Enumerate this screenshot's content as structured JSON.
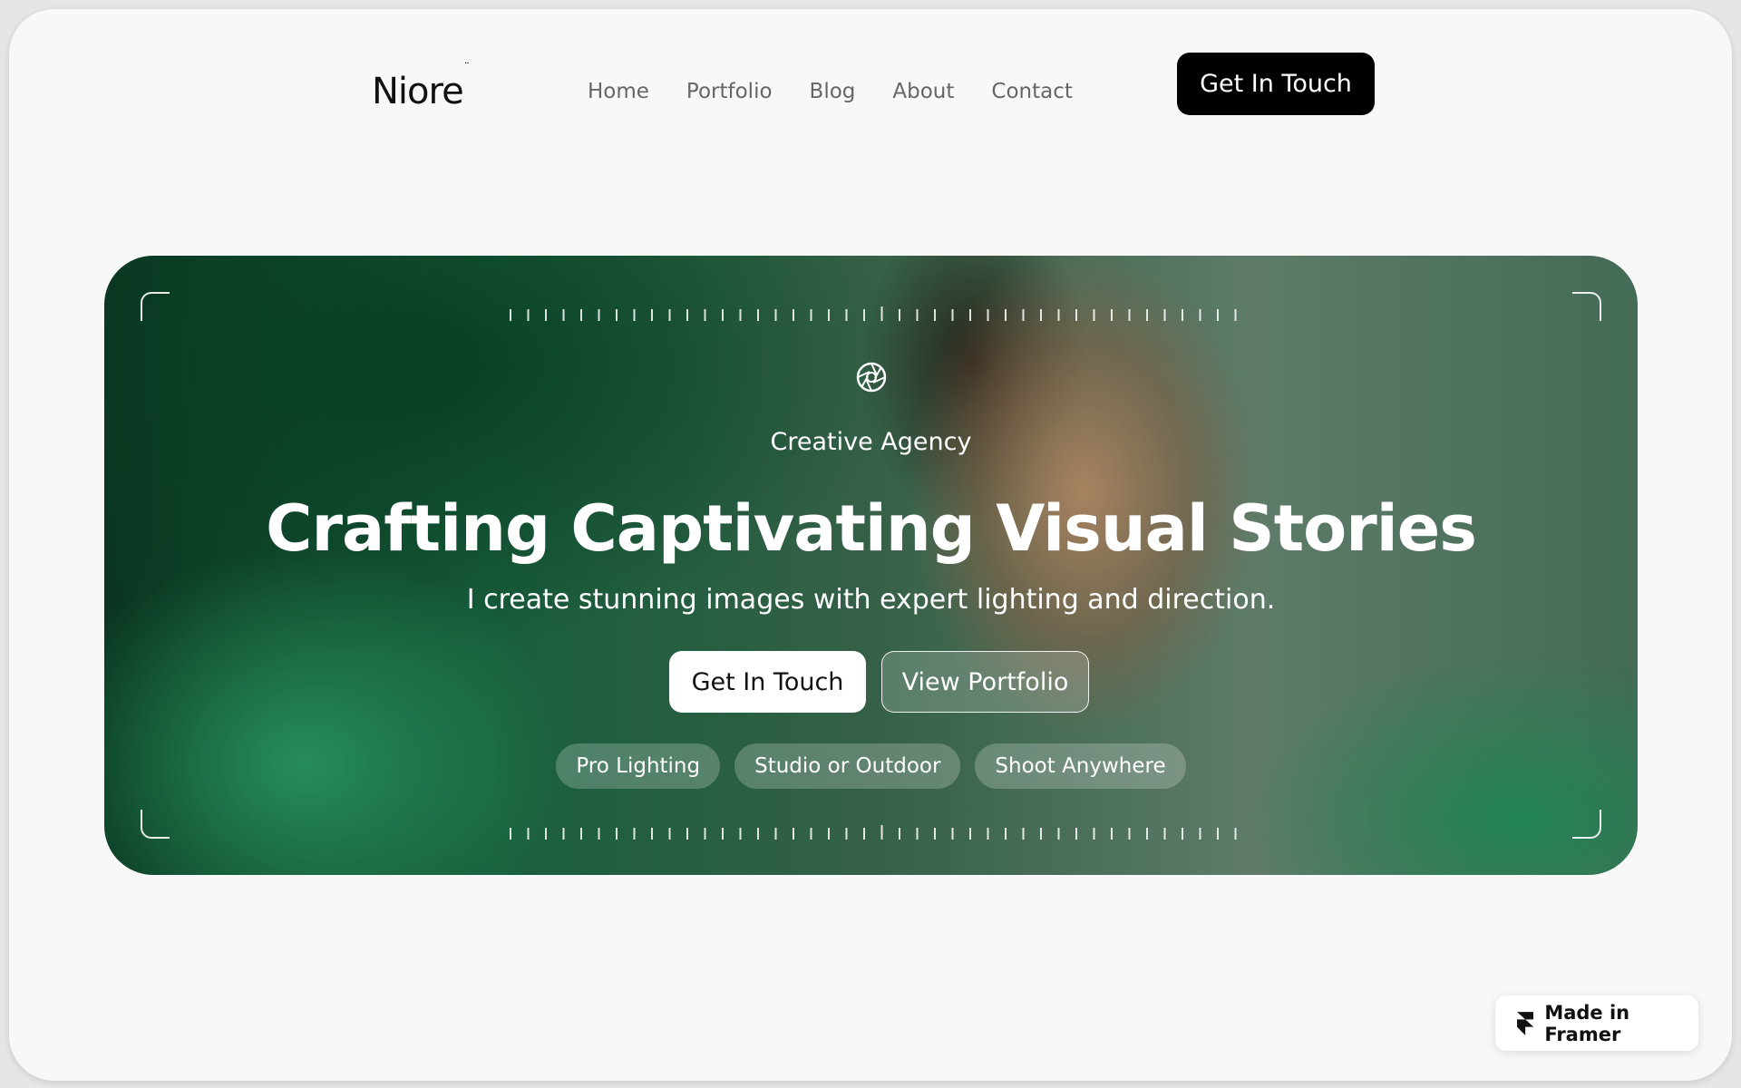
{
  "brand": {
    "name": "Niore",
    "mark": "¨"
  },
  "nav": {
    "items": [
      {
        "label": "Home"
      },
      {
        "label": "Portfolio"
      },
      {
        "label": "Blog"
      },
      {
        "label": "About"
      },
      {
        "label": "Contact"
      }
    ],
    "cta_label": "Get In Touch"
  },
  "hero": {
    "icon": "aperture-icon",
    "eyebrow": "Creative Agency",
    "headline": "Crafting Captivating Visual Stories",
    "subheadline": "I create stunning images with expert lighting and direction.",
    "primary_button": "Get In Touch",
    "secondary_button": "View Portfolio",
    "chips": [
      "Pro Lighting",
      "Studio or Outdoor",
      "Shoot Anywhere"
    ]
  },
  "badge": {
    "label": "Made in Framer",
    "icon": "framer-icon"
  },
  "colors": {
    "background": "#f8f8f8",
    "nav_cta": "#000000",
    "hero_green": "#1b6b45",
    "text_muted": "#666666"
  }
}
